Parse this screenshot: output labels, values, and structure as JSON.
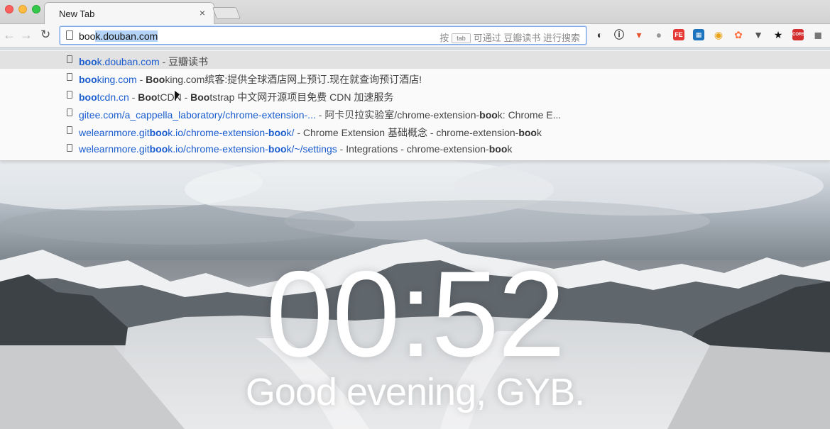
{
  "tab": {
    "title": "New Tab",
    "close": "×"
  },
  "toolbar": {
    "back": "←",
    "forward": "→",
    "reload": "↻",
    "omnibox": {
      "typed": "boo",
      "autocompleted": "k.douban.com",
      "hint_prefix": "按",
      "hint_key": "tab",
      "hint_suffix": "可通过 豆瓣读书 进行搜索"
    },
    "extensions": [
      {
        "name": "extension-icon-1",
        "glyph": "◐",
        "color": "#333"
      },
      {
        "name": "extension-icon-2",
        "glyph": "ⓘ",
        "color": "#333"
      },
      {
        "name": "extension-icon-3",
        "glyph": "▾",
        "color": "#e5532d"
      },
      {
        "name": "extension-icon-4",
        "glyph": "●",
        "color": "#9a9a9a"
      },
      {
        "name": "extension-icon-5",
        "glyph": "FE",
        "color": "#e53935"
      },
      {
        "name": "extension-icon-6",
        "glyph": "▦",
        "color": "#1e73be"
      },
      {
        "name": "extension-icon-7",
        "glyph": "◉",
        "color": "#e8a317"
      },
      {
        "name": "extension-icon-8",
        "glyph": "✿",
        "color": "#ff7043"
      },
      {
        "name": "pocket-icon",
        "glyph": "▼",
        "color": "#555"
      },
      {
        "name": "star-icon",
        "glyph": "★",
        "color": "#111"
      },
      {
        "name": "cors-icon",
        "glyph": "CORS",
        "color": "#d32f2f"
      },
      {
        "name": "extension-icon-12",
        "glyph": "◼",
        "color": "#777"
      }
    ]
  },
  "suggestions": [
    {
      "url_bold": "boo",
      "url_rest": "k.douban.com",
      "sep": " - ",
      "title_parts": [
        [
          "",
          "豆瓣读书"
        ]
      ]
    },
    {
      "url_bold": "boo",
      "url_rest": "king.com",
      "sep": " - ",
      "title_parts": [
        [
          "Boo",
          "king.com缤客:提供全球酒店网上预订.现在就查询预订酒店!"
        ]
      ]
    },
    {
      "url_bold": "boo",
      "url_rest": "tcdn.cn",
      "sep": " - ",
      "title_parts": [
        [
          "Boo",
          "tCDN - "
        ],
        [
          "Boo",
          "tstrap 中文网开源项目免费 CDN 加速服务"
        ]
      ]
    },
    {
      "url_bold": "",
      "url_rest": "gitee.com/a_cappella_laboratory/chrome-extension-...",
      "sep": " - ",
      "title_parts": [
        [
          "",
          "阿卡贝拉实验室/chrome-extension-"
        ],
        [
          "boo",
          "k: Chrome E..."
        ]
      ]
    },
    {
      "url_bold": "",
      "url_rest": "welearnmore.git",
      "url_bold2": "boo",
      "url_rest2": "k.io/chrome-extension-",
      "url_bold3": "boo",
      "url_rest3": "k/",
      "sep": " - ",
      "title_parts": [
        [
          "",
          "Chrome Extension 基础概念 - chrome-extension-"
        ],
        [
          "boo",
          "k"
        ]
      ]
    },
    {
      "url_bold": "",
      "url_rest": "welearnmore.git",
      "url_bold2": "boo",
      "url_rest2": "k.io/chrome-extension-",
      "url_bold3": "boo",
      "url_rest3": "k/~/settings",
      "sep": " - ",
      "title_parts": [
        [
          "",
          "Integrations - chrome-extension-"
        ],
        [
          "boo",
          "k"
        ]
      ]
    }
  ],
  "page": {
    "clock": "00:52",
    "greeting": "Good evening, GYB."
  }
}
